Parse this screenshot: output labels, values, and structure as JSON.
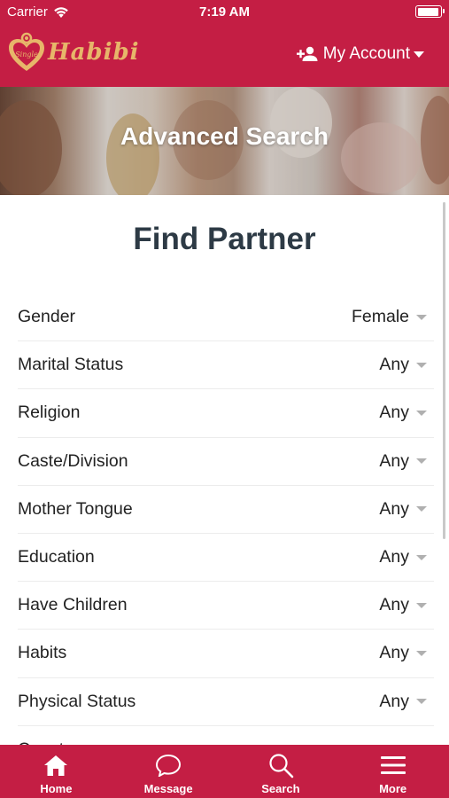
{
  "status_bar": {
    "carrier": "Carrier",
    "time": "7:19 AM",
    "battery_level": 0.95
  },
  "header": {
    "logo_small_text": "Single",
    "logo_text": "Habibi",
    "account_label": "My Account"
  },
  "banner": {
    "title": "Advanced Search"
  },
  "main": {
    "title": "Find Partner",
    "filters": [
      {
        "label": "Gender",
        "value": "Female"
      },
      {
        "label": "Marital Status",
        "value": "Any"
      },
      {
        "label": "Religion",
        "value": "Any"
      },
      {
        "label": "Caste/Division",
        "value": "Any"
      },
      {
        "label": "Mother Tongue",
        "value": "Any"
      },
      {
        "label": "Education",
        "value": "Any"
      },
      {
        "label": "Have Children",
        "value": "Any"
      },
      {
        "label": "Habits",
        "value": "Any"
      },
      {
        "label": "Physical Status",
        "value": "Any"
      },
      {
        "label": "Country",
        "value": ""
      }
    ]
  },
  "tabbar": {
    "tabs": [
      {
        "label": "Home",
        "icon": "home-icon"
      },
      {
        "label": "Message",
        "icon": "message-icon"
      },
      {
        "label": "Search",
        "icon": "search-icon"
      },
      {
        "label": "More",
        "icon": "menu-icon"
      }
    ]
  },
  "colors": {
    "brand": "#c41e44",
    "logo_gold": "#e7b66a",
    "title_text": "#2d3a45"
  }
}
